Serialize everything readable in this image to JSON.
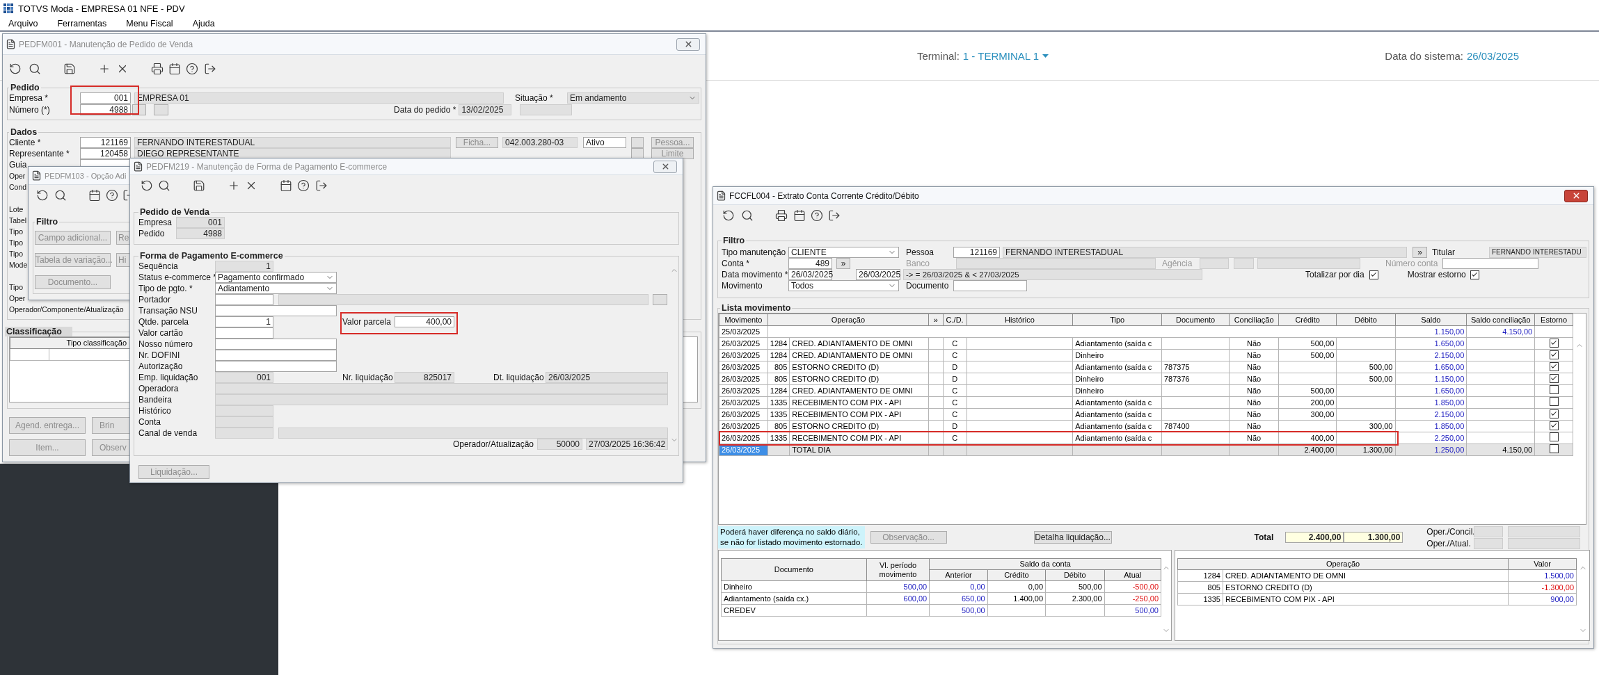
{
  "app": {
    "title": "TOTVS Moda - EMPRESA 01 NFE - PDV",
    "menu": [
      "Arquivo",
      "Ferramentas",
      "Menu Fiscal",
      "Ajuda"
    ]
  },
  "header": {
    "terminal_label": "Terminal:",
    "terminal": "1 - TERMINAL 1",
    "date_label": "Data do sistema:",
    "date": "26/03/2025"
  },
  "pedido_window": {
    "title": "PEDFM001 - Manutenção de Pedido de Venda",
    "active": false,
    "pedido": {
      "legend": "Pedido",
      "empresa_label": "Empresa *",
      "empresa": "001",
      "empresa_nome": "EMPRESA 01",
      "situacao_label": "Situação *",
      "situacao": "Em andamento",
      "numero_label": "Número (*)",
      "numero": "4988",
      "data_label": "Data do pedido *",
      "data": "13/02/2025",
      "highlighted": true
    },
    "dados": {
      "legend": "Dados",
      "cliente_label": "Cliente *",
      "cliente": "121169",
      "cliente_nome": "FERNANDO INTERESTADUAL",
      "ficha_button": "Ficha...",
      "documento": "042.003.280-03",
      "status": "Ativo",
      "pessoa_button": "Pessoa...",
      "representante_label": "Representante *",
      "representante": "120458",
      "representante_nome": "DIEGO REPRESENTANTE",
      "limite_button": "Limite",
      "guia_label": "Guia",
      "label_groups": [
        [
          "Oper",
          "Cond"
        ],
        [
          "Lote",
          "Tabel",
          "Tipo",
          "Tipo",
          "Tipo",
          "Mode"
        ],
        [
          "Tipo",
          "Oper",
          "Operador/Componente/Atualização"
        ]
      ]
    },
    "classificacao": {
      "legend": "Classificação",
      "column": "Tipo classificação"
    },
    "buttons": [
      [
        "Agend. entrega...",
        "Brin"
      ],
      [
        "Item...",
        "Observ"
      ]
    ]
  },
  "opcao_window": {
    "title": "PEDFM103 - Opção Adi",
    "active": false,
    "legend": "Filtro",
    "buttons": [
      [
        "Campo adicional...",
        "Re"
      ],
      [
        "Tabela de variação...",
        "Hi"
      ],
      [
        "Documento..."
      ]
    ]
  },
  "pagamento_window": {
    "title": "PEDFM219 - Manutenção de Forma de Pagamento E-commerce",
    "active": false,
    "pedido_legend": "Pedido de Venda",
    "empresa_label": "Empresa",
    "empresa": "001",
    "pedido_label": "Pedido",
    "pedido": "4988",
    "forma_legend": "Forma de Pagamento E-commerce",
    "sequencia_label": "Sequência",
    "sequencia": "1",
    "status_label": "Status e-commerce *",
    "status": "Pagamento confirmado",
    "tipo_label": "Tipo de pgto. *",
    "tipo": "Adiantamento",
    "portador_label": "Portador",
    "nsu_label": "Transação NSU",
    "parcela_label": "Qtde. parcela",
    "parcela": "1",
    "valor_parcela_label": "Valor parcela",
    "valor_parcela": "400,00",
    "valor_highlighted": true,
    "valor_cartao_label": "Valor cartão",
    "nosso_numero_label": "Nosso número",
    "dofini_label": "Nr. DOFINI",
    "autorizacao_label": "Autorização",
    "emp_liq_label": "Emp. liquidação",
    "emp_liq": "001",
    "nr_liq_label": "Nr. liquidação",
    "nr_liq": "825017",
    "dt_liq_label": "Dt. liquidação",
    "dt_liq": "26/03/2025",
    "operadora_label": "Operadora",
    "bandeira_label": "Bandeira",
    "historico_label": "Histórico",
    "conta_label": "Conta",
    "canal_label": "Canal de venda",
    "operador_label": "Operador/Atualização",
    "operador": "50000",
    "atualizacao": "27/03/2025 16:36:42",
    "liquidacao_button": "Liquidação..."
  },
  "extrato_window": {
    "title": "FCCFL004 - Extrato Conta Corrente Crédito/Débito",
    "active": true,
    "filtro_legend": "Filtro",
    "tipo_label": "Tipo manutenção",
    "tipo": "CLIENTE",
    "pessoa_label": "Pessoa",
    "pessoa": "121169",
    "pessoa_nome": "FERNANDO INTERESTADUAL",
    "pessoa_more": "»",
    "titular_label": "Titular",
    "titular": "FERNANDO INTERESTADU",
    "conta_label": "Conta *",
    "conta": "489",
    "conta_more": "»",
    "banco_label": "Banco",
    "agencia_label": "Agência",
    "numero_conta_label": "Número conta",
    "data_label": "Data movimento *",
    "data_de": "26/03/2025",
    "data_ate": "26/03/2025",
    "intervalo": "-> = 26/03/2025  & < 27/03/2025",
    "totalizar_label": "Totalizar por dia",
    "totalizar_checked": true,
    "estorno_label": "Mostrar estorno",
    "estorno_checked": true,
    "movimento_label": "Movimento",
    "movimento": "Todos",
    "documento_label": "Documento",
    "lista_legend": "Lista movimento",
    "columns": [
      "Movimento",
      "Operação",
      "»",
      "C./D.",
      "Histórico",
      "Tipo",
      "Documento",
      "Conciliação",
      "Crédito",
      "Débito",
      "Saldo",
      "Saldo conciliação",
      "Estorno"
    ],
    "rows": [
      {
        "kind": "opening",
        "movimento": "25/03/2025",
        "saldo": "1.150,00",
        "saldo_conciliacao": "4.150,00",
        "selected": false,
        "highlighted": false
      },
      {
        "kind": "entry",
        "movimento": "26/03/2025",
        "codigo": "1284",
        "operacao": "CRED. ADIANTAMENTO DE OMNI",
        "cd": "C",
        "tipo": "Adiantamento (saída c",
        "conciliacao": "Não",
        "credito": "500,00",
        "saldo": "1.650,00",
        "estorno": true,
        "selected": false,
        "highlighted": false
      },
      {
        "kind": "entry",
        "movimento": "26/03/2025",
        "codigo": "1284",
        "operacao": "CRED. ADIANTAMENTO DE OMNI",
        "cd": "C",
        "tipo": "Dinheiro",
        "conciliacao": "Não",
        "credito": "500,00",
        "saldo": "2.150,00",
        "estorno": true,
        "selected": false,
        "highlighted": false
      },
      {
        "kind": "entry",
        "movimento": "26/03/2025",
        "codigo": "805",
        "operacao": "ESTORNO CREDITO (D)",
        "cd": "D",
        "tipo": "Adiantamento (saída c",
        "documento": "787375",
        "conciliacao": "Não",
        "debito": "500,00",
        "saldo": "1.650,00",
        "estorno": true,
        "selected": false,
        "highlighted": false
      },
      {
        "kind": "entry",
        "movimento": "26/03/2025",
        "codigo": "805",
        "operacao": "ESTORNO CREDITO (D)",
        "cd": "D",
        "tipo": "Dinheiro",
        "documento": "787376",
        "conciliacao": "Não",
        "debito": "500,00",
        "saldo": "1.150,00",
        "estorno": true,
        "selected": false,
        "highlighted": false
      },
      {
        "kind": "entry",
        "movimento": "26/03/2025",
        "codigo": "1284",
        "operacao": "CRED. ADIANTAMENTO DE OMNI",
        "cd": "C",
        "tipo": "Dinheiro",
        "conciliacao": "Não",
        "credito": "500,00",
        "saldo": "1.650,00",
        "estorno": false,
        "selected": false,
        "highlighted": false
      },
      {
        "kind": "entry",
        "movimento": "26/03/2025",
        "codigo": "1335",
        "operacao": "RECEBIMENTO COM PIX - API",
        "cd": "C",
        "tipo": "Adiantamento (saída c",
        "conciliacao": "Não",
        "credito": "200,00",
        "saldo": "1.850,00",
        "estorno": false,
        "selected": false,
        "highlighted": false
      },
      {
        "kind": "entry",
        "movimento": "26/03/2025",
        "codigo": "1335",
        "operacao": "RECEBIMENTO COM PIX - API",
        "cd": "C",
        "tipo": "Adiantamento (saída c",
        "conciliacao": "Não",
        "credito": "300,00",
        "saldo": "2.150,00",
        "estorno": true,
        "selected": false,
        "highlighted": false
      },
      {
        "kind": "entry",
        "movimento": "26/03/2025",
        "codigo": "805",
        "operacao": "ESTORNO CREDITO (D)",
        "cd": "D",
        "tipo": "Adiantamento (saída c",
        "documento": "787400",
        "conciliacao": "Não",
        "debito": "300,00",
        "saldo": "1.850,00",
        "estorno": true,
        "selected": false,
        "highlighted": false
      },
      {
        "kind": "entry",
        "movimento": "26/03/2025",
        "codigo": "1335",
        "operacao": "RECEBIMENTO COM PIX - API",
        "cd": "C",
        "tipo": "Adiantamento (saída c",
        "conciliacao": "Não",
        "credito": "400,00",
        "saldo": "2.250,00",
        "estorno": false,
        "selected": false,
        "highlighted": true
      },
      {
        "kind": "total",
        "movimento": "26/03/2025",
        "operacao": "TOTAL DIA",
        "credito": "2.400,00",
        "debito": "1.300,00",
        "saldo": "1.250,00",
        "saldo_conciliacao": "4.150,00",
        "estorno": false,
        "selected": true,
        "highlighted": false
      }
    ],
    "aviso": "Poderá haver diferença no saldo diário,\nse não for listado movimento estornado.",
    "observacao_button": "Observação...",
    "observacao_disabled": true,
    "detalha_button": "Detalha liquidação...",
    "total_label": "Total",
    "total_credito": "2.400,00",
    "total_debito": "1.300,00",
    "oper_concil_label": "Oper./Concil.",
    "oper_atual_label": "Oper./Atual.",
    "saldo_table": {
      "documento": "Documento",
      "periodo": "Vl. período movimento",
      "saldo_conta": "Saldo da conta",
      "sub": [
        "Anterior",
        "Crédito",
        "Débito",
        "Atual"
      ],
      "rows": [
        {
          "documento": "Dinheiro",
          "periodo": "500,00",
          "anterior": "0,00",
          "credito": "0,00",
          "debito": "500,00",
          "atual": "-500,00",
          "negative": true
        },
        {
          "documento": "Adiantamento (saída cx.)",
          "periodo": "600,00",
          "anterior": "650,00",
          "credito": "1.400,00",
          "debito": "2.300,00",
          "atual": "-250,00",
          "negative": true
        },
        {
          "documento": "CREDEV",
          "anterior": "500,00",
          "atual": "500,00",
          "negative": false
        }
      ]
    },
    "operacao_table": {
      "columns": [
        "Operação",
        "Valor"
      ],
      "rows": [
        {
          "codigo": "1284",
          "operacao": "CRED. ADIANTAMENTO DE OMNI",
          "valor": "1.500,00",
          "negative": false
        },
        {
          "codigo": "805",
          "operacao": "ESTORNO CREDITO (D)",
          "valor": "-1.300,00",
          "negative": true
        },
        {
          "codigo": "1335",
          "operacao": "RECEBIMENTO COM PIX - API",
          "valor": "900,00",
          "negative": false
        }
      ]
    }
  }
}
